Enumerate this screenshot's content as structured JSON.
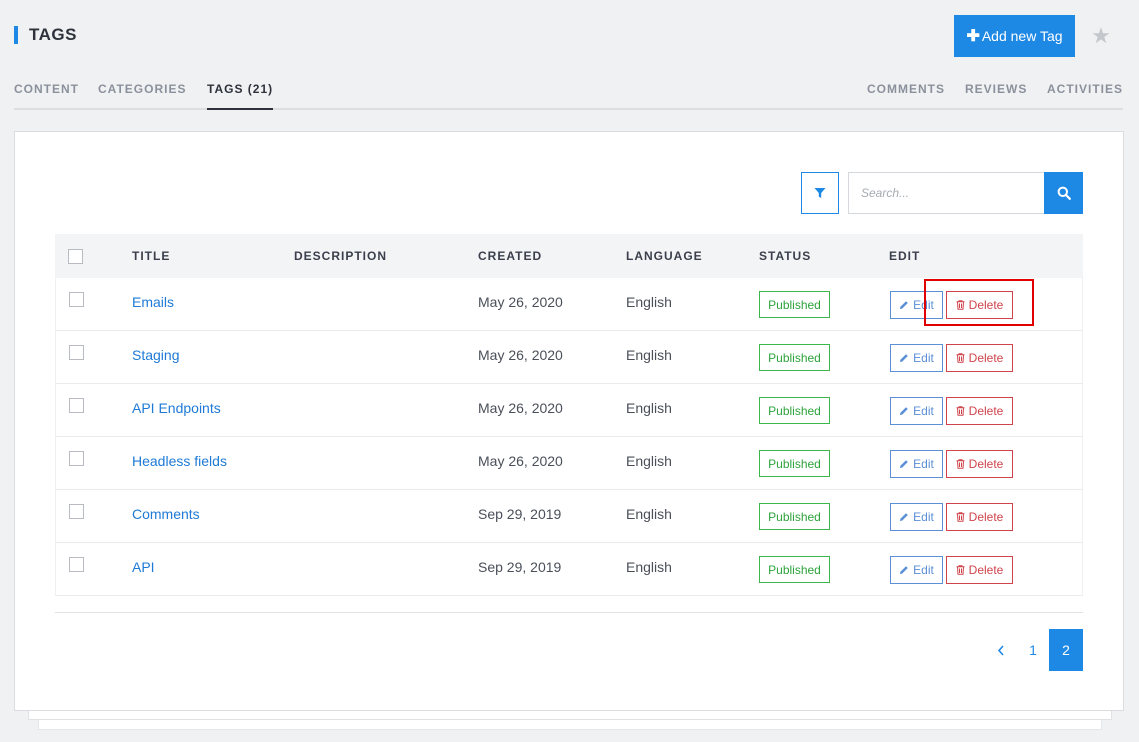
{
  "header": {
    "title": "TAGS",
    "add_button_label": "Add new Tag",
    "accent_color": "#1e88e5"
  },
  "tabs": {
    "left": [
      {
        "label": "CONTENT"
      },
      {
        "label": "CATEGORIES"
      },
      {
        "label": "TAGS (21)",
        "active": true
      }
    ],
    "right": [
      {
        "label": "COMMENTS"
      },
      {
        "label": "REVIEWS"
      },
      {
        "label": "ACTIVITIES"
      }
    ]
  },
  "search": {
    "placeholder": "Search...",
    "value": ""
  },
  "table": {
    "headers": {
      "title": "TITLE",
      "description": "DESCRIPTION",
      "created": "CREATED",
      "language": "LANGUAGE",
      "status": "STATUS",
      "edit": "EDIT"
    },
    "rows": [
      {
        "title": "Emails",
        "description": "",
        "created": "May 26, 2020",
        "language": "English",
        "status": "Published"
      },
      {
        "title": "Staging",
        "description": "",
        "created": "May 26, 2020",
        "language": "English",
        "status": "Published"
      },
      {
        "title": "API Endpoints",
        "description": "",
        "created": "May 26, 2020",
        "language": "English",
        "status": "Published"
      },
      {
        "title": "Headless fields",
        "description": "",
        "created": "May 26, 2020",
        "language": "English",
        "status": "Published"
      },
      {
        "title": "Comments",
        "description": "",
        "created": "Sep 29, 2019",
        "language": "English",
        "status": "Published"
      },
      {
        "title": "API",
        "description": "",
        "created": "Sep 29, 2019",
        "language": "English",
        "status": "Published"
      }
    ],
    "edit_label": "Edit",
    "delete_label": "Delete"
  },
  "pagination": {
    "pages": [
      "1",
      "2"
    ],
    "current": "2"
  },
  "icons": {
    "star": "star-icon",
    "filter": "filter-icon",
    "search": "search-icon",
    "pencil": "pencil-icon",
    "trash": "trash-icon",
    "chevron": "chevron-left-icon"
  }
}
